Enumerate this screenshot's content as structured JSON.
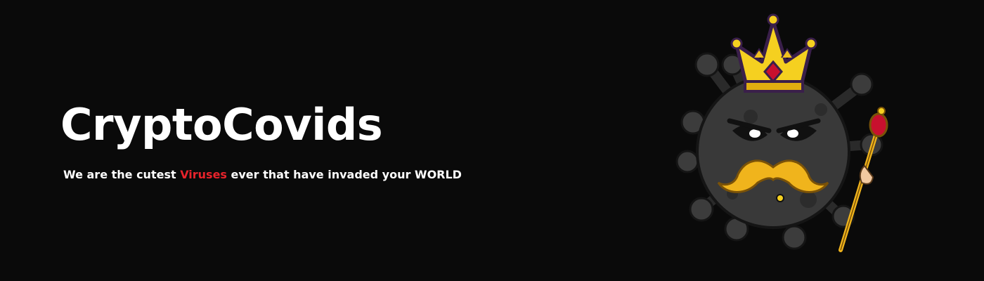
{
  "banner": {
    "title": "CryptoCovids",
    "tagline_before": "We are the cutest ",
    "tagline_highlight": "Viruses",
    "tagline_after": " ever that have invaded your WORLD",
    "highlight_color": "#e8232b",
    "background_color": "#0a0a0a"
  },
  "mascot": {
    "icon": "virus-king-mascot-icon",
    "parts": [
      "crown-icon",
      "mustache-icon",
      "scepter-icon"
    ],
    "crown_color": "#f5d020",
    "body_color": "#3a3a3a"
  }
}
